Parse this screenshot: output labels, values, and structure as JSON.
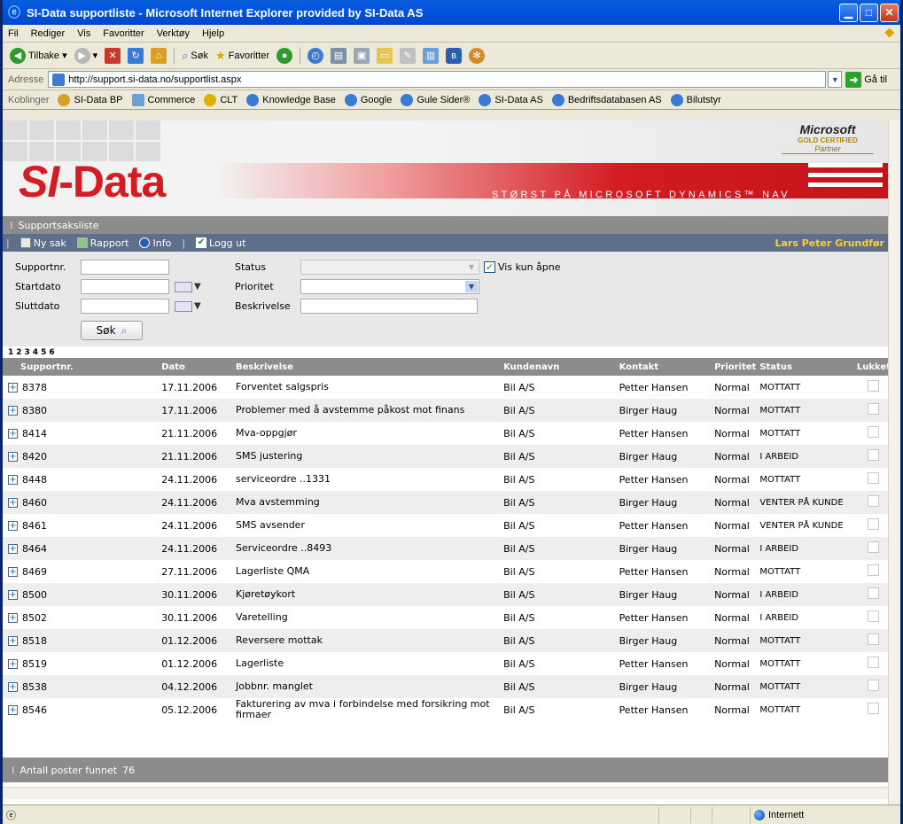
{
  "window": {
    "title": "SI-Data supportliste - Microsoft Internet Explorer provided by SI-Data AS"
  },
  "menu": [
    "Fil",
    "Rediger",
    "Vis",
    "Favoritter",
    "Verktøy",
    "Hjelp"
  ],
  "toolbar": {
    "back": "Tilbake",
    "search": "Søk",
    "favorites": "Favoritter"
  },
  "address": {
    "label": "Adresse",
    "url": "http://support.si-data.no/supportlist.aspx",
    "go": "Gå til"
  },
  "links": {
    "label": "Koblinger",
    "items": [
      "SI-Data BP",
      "Commerce",
      "CLT",
      "Knowledge Base",
      "Google",
      "Gule Sider®",
      "SI-Data AS",
      "Bedriftsdatabasen AS",
      "Bilutstyr"
    ]
  },
  "banner": {
    "logo_mark": "SI",
    "logo_text": "-Data",
    "slogan": "STØRST PÅ MICROSOFT DYNAMICS™ NAV",
    "ms_logo": "Microsoft",
    "ms_gold": "GOLD CERTIFIED",
    "ms_partner": "Partner"
  },
  "section_title": "Supportsaksliste",
  "actions": {
    "new": "Ny sak",
    "report": "Rapport",
    "info": "Info",
    "logout": "Logg ut",
    "user": "Lars Peter Grundfør"
  },
  "filters": {
    "supportnr_label": "Supportnr.",
    "startdato_label": "Startdato",
    "sluttdato_label": "Sluttdato",
    "status_label": "Status",
    "prioritet_label": "Prioritet",
    "beskrivelse_label": "Beskrivelse",
    "vis_kun_apne": "Vis kun åpne",
    "search_button": "Søk"
  },
  "pages": [
    "1",
    "2",
    "3",
    "4",
    "5",
    "6"
  ],
  "table": {
    "headers": [
      "Supportnr.",
      "Dato",
      "Beskrivelse",
      "Kundenavn",
      "Kontakt",
      "Prioritet",
      "Status",
      "Lukket"
    ],
    "rows": [
      [
        "8378",
        "17.11.2006",
        "Forventet salgspris",
        "Bil A/S",
        "Petter Hansen",
        "Normal",
        "MOTTATT"
      ],
      [
        "8380",
        "17.11.2006",
        "Problemer med å avstemme påkost mot finans",
        "Bil A/S",
        "Birger Haug",
        "Normal",
        "MOTTATT"
      ],
      [
        "8414",
        "21.11.2006",
        "Mva-oppgjør",
        "Bil A/S",
        "Petter Hansen",
        "Normal",
        "MOTTATT"
      ],
      [
        "8420",
        "21.11.2006",
        "SMS justering",
        "Bil A/S",
        "Birger Haug",
        "Normal",
        "I ARBEID"
      ],
      [
        "8448",
        "24.11.2006",
        "serviceordre ..1331",
        "Bil A/S",
        "Petter Hansen",
        "Normal",
        "MOTTATT"
      ],
      [
        "8460",
        "24.11.2006",
        "Mva avstemming",
        "Bil A/S",
        "Birger Haug",
        "Normal",
        "VENTER PÅ KUNDE"
      ],
      [
        "8461",
        "24.11.2006",
        "SMS avsender",
        "Bil A/S",
        "Petter Hansen",
        "Normal",
        "VENTER PÅ KUNDE"
      ],
      [
        "8464",
        "24.11.2006",
        "Serviceordre ..8493",
        "Bil A/S",
        "Birger Haug",
        "Normal",
        "I ARBEID"
      ],
      [
        "8469",
        "27.11.2006",
        "Lagerliste QMA",
        "Bil A/S",
        "Petter Hansen",
        "Normal",
        "MOTTATT"
      ],
      [
        "8500",
        "30.11.2006",
        "Kjøretøykort",
        "Bil A/S",
        "Birger Haug",
        "Normal",
        "I ARBEID"
      ],
      [
        "8502",
        "30.11.2006",
        "Varetelling",
        "Bil A/S",
        "Petter Hansen",
        "Normal",
        "I ARBEID"
      ],
      [
        "8518",
        "01.12.2006",
        "Reversere mottak",
        "Bil A/S",
        "Birger Haug",
        "Normal",
        "MOTTATT"
      ],
      [
        "8519",
        "01.12.2006",
        "Lagerliste",
        "Bil A/S",
        "Petter Hansen",
        "Normal",
        "MOTTATT"
      ],
      [
        "8538",
        "04.12.2006",
        "Jobbnr. manglet",
        "Bil A/S",
        "Birger Haug",
        "Normal",
        "MOTTATT"
      ],
      [
        "8546",
        "05.12.2006",
        "Fakturering av mva i forbindelse med forsikring mot firmaer",
        "Bil A/S",
        "Petter Hansen",
        "Normal",
        "MOTTATT"
      ]
    ]
  },
  "footer": {
    "label": "Antall poster funnet",
    "count": "76"
  },
  "statusbar": {
    "zone": "Internett"
  },
  "colors": {
    "brand_red": "#d41c22",
    "action_bar": "#5e6f8b",
    "user_name": "#ffcc33"
  }
}
